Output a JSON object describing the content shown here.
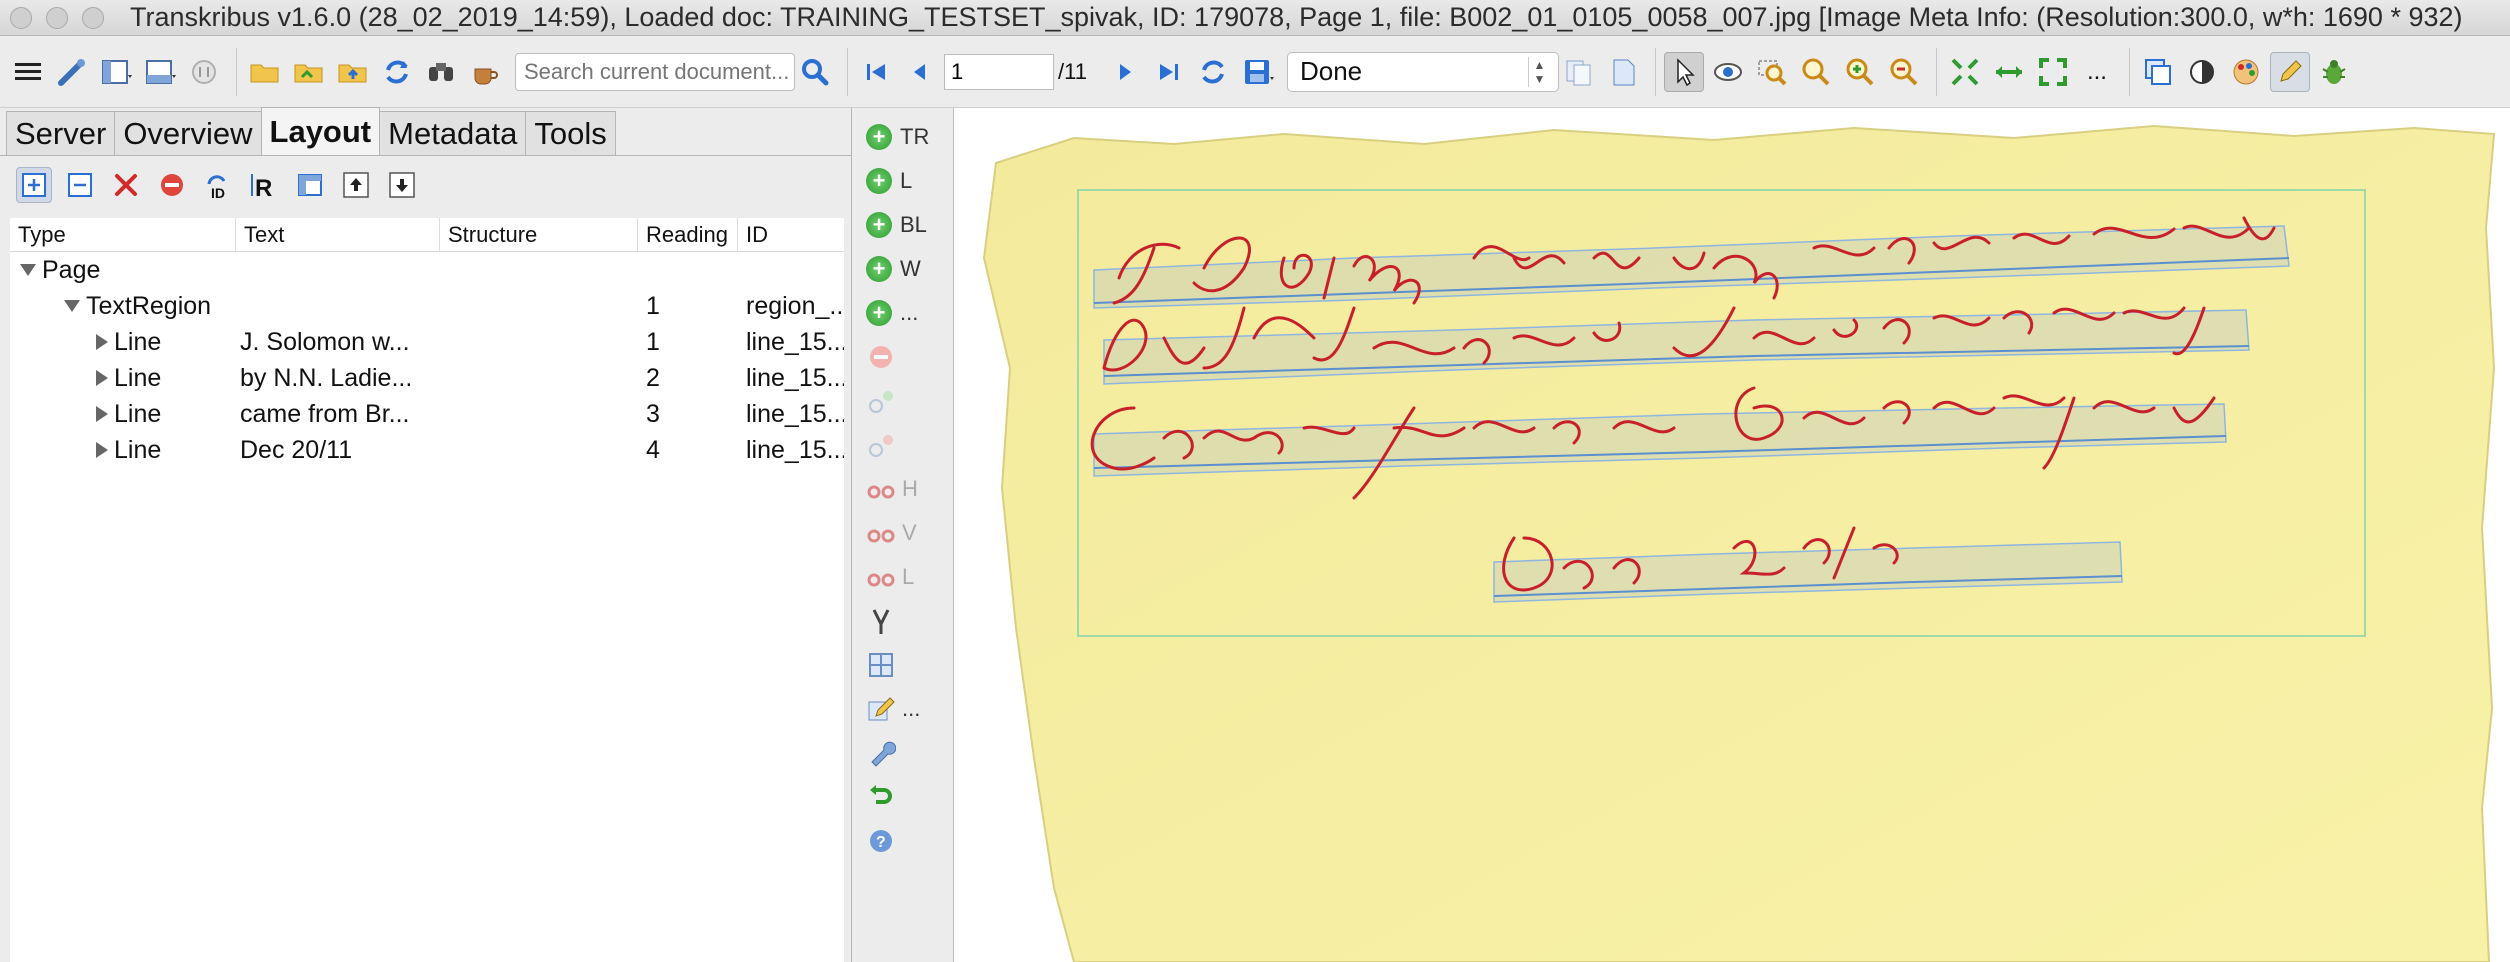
{
  "window": {
    "title": "Transkribus v1.6.0 (28_02_2019_14:59), Loaded doc: TRAINING_TESTSET_spivak, ID: 179078, Page 1, file: B002_01_0105_0058_007.jpg [Image Meta Info: (Resolution:300.0, w*h: 1690 * 932)"
  },
  "toolbar": {
    "search_placeholder": "Search current document...",
    "page_current": "1",
    "page_total": "/11",
    "status_value": "Done",
    "more_label": "..."
  },
  "tabs": [
    "Server",
    "Overview",
    "Layout",
    "Metadata",
    "Tools"
  ],
  "tree": {
    "columns": [
      "Type",
      "Text",
      "Structure",
      "Reading",
      "ID"
    ],
    "rows": [
      {
        "type": "Page",
        "text": "",
        "structure": "",
        "reading": "",
        "id": ""
      },
      {
        "type": "TextRegion",
        "text": "",
        "structure": "",
        "reading": "1",
        "id": "region_..."
      },
      {
        "type": "Line",
        "text": "J. Solomon w...",
        "structure": "",
        "reading": "1",
        "id": "line_15..."
      },
      {
        "type": "Line",
        "text": "by N.N. Ladie...",
        "structure": "",
        "reading": "2",
        "id": "line_15..."
      },
      {
        "type": "Line",
        "text": "came from Br...",
        "structure": "",
        "reading": "3",
        "id": "line_15..."
      },
      {
        "type": "Line",
        "text": "Dec 20/11",
        "structure": "",
        "reading": "4",
        "id": "line_15..."
      }
    ]
  },
  "vstrip": {
    "add_tr": "TR",
    "add_l": "L",
    "add_bl": "BL",
    "add_w": "W",
    "add_more": "...",
    "split_h": "H",
    "split_v": "V",
    "split_l": "L",
    "edit_more": "..."
  },
  "colors": {
    "paper": "#f6ee9f",
    "ink": "#c8202a",
    "region_outline": "#9fd9a8",
    "baseline": "#8fb6e0",
    "accent_blue": "#2a6fd1"
  }
}
